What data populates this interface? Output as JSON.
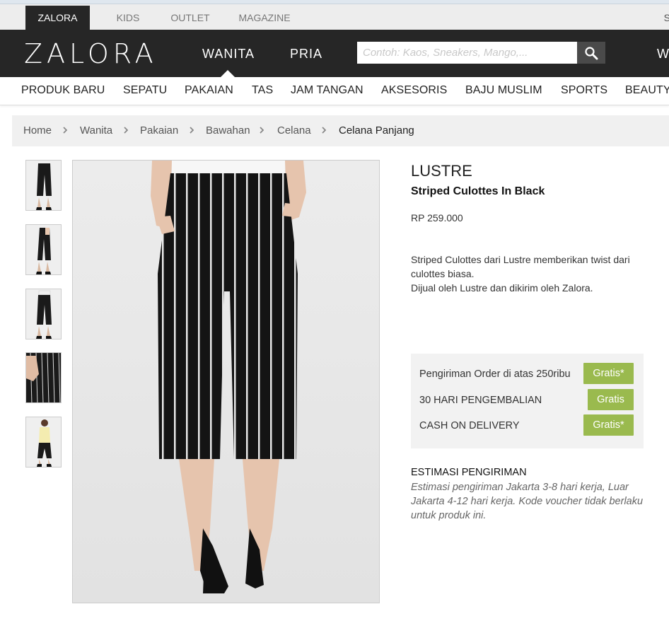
{
  "topbar": {
    "tabs": [
      {
        "label": "ZALORA"
      },
      {
        "label": "KIDS"
      },
      {
        "label": "OUTLET"
      },
      {
        "label": "MAGAZINE"
      }
    ],
    "right_cut": "S"
  },
  "header": {
    "logo": "ZALORA",
    "genders": [
      {
        "label": "WANITA"
      },
      {
        "label": "PRIA"
      }
    ],
    "search_placeholder": "Contoh: Kaos, Sneakers, Mango,...",
    "right_cut": "W"
  },
  "categories": [
    {
      "label": "PRODUK BARU"
    },
    {
      "label": "SEPATU"
    },
    {
      "label": "PAKAIAN"
    },
    {
      "label": "TAS"
    },
    {
      "label": "JAM TANGAN"
    },
    {
      "label": "AKSESORIS"
    },
    {
      "label": "BAJU MUSLIM"
    },
    {
      "label": "SPORTS"
    },
    {
      "label": "BEAUTY"
    }
  ],
  "breadcrumb": [
    {
      "label": "Home"
    },
    {
      "label": "Wanita"
    },
    {
      "label": "Pakaian"
    },
    {
      "label": "Bawahan"
    },
    {
      "label": "Celana"
    },
    {
      "label": "Celana Panjang"
    }
  ],
  "product": {
    "brand": "LUSTRE",
    "name": "Striped Culottes In Black",
    "price": "RP 259.000",
    "description": [
      "Striped Culottes dari Lustre memberikan twist dari culottes biasa.",
      "Dijual oleh Lustre dan dikirim oleh Zalora."
    ]
  },
  "benefits": [
    {
      "label": "Pengiriman Order di atas 250ribu",
      "badge": "Gratis*"
    },
    {
      "label": "30 HARI PENGEMBALIAN",
      "badge": "Gratis"
    },
    {
      "label": "CASH ON DELIVERY",
      "badge": "Gratis*"
    }
  ],
  "shipping_estimate": {
    "title": "ESTIMASI PENGIRIMAN",
    "text": "Estimasi pengiriman Jakarta 3-8 hari kerja, Luar Jakarta 4-12 hari kerja. Kode voucher tidak berlaku untuk produk ini."
  },
  "colors": {
    "header_bg": "#262626",
    "gratis_green": "#9aba4e"
  }
}
